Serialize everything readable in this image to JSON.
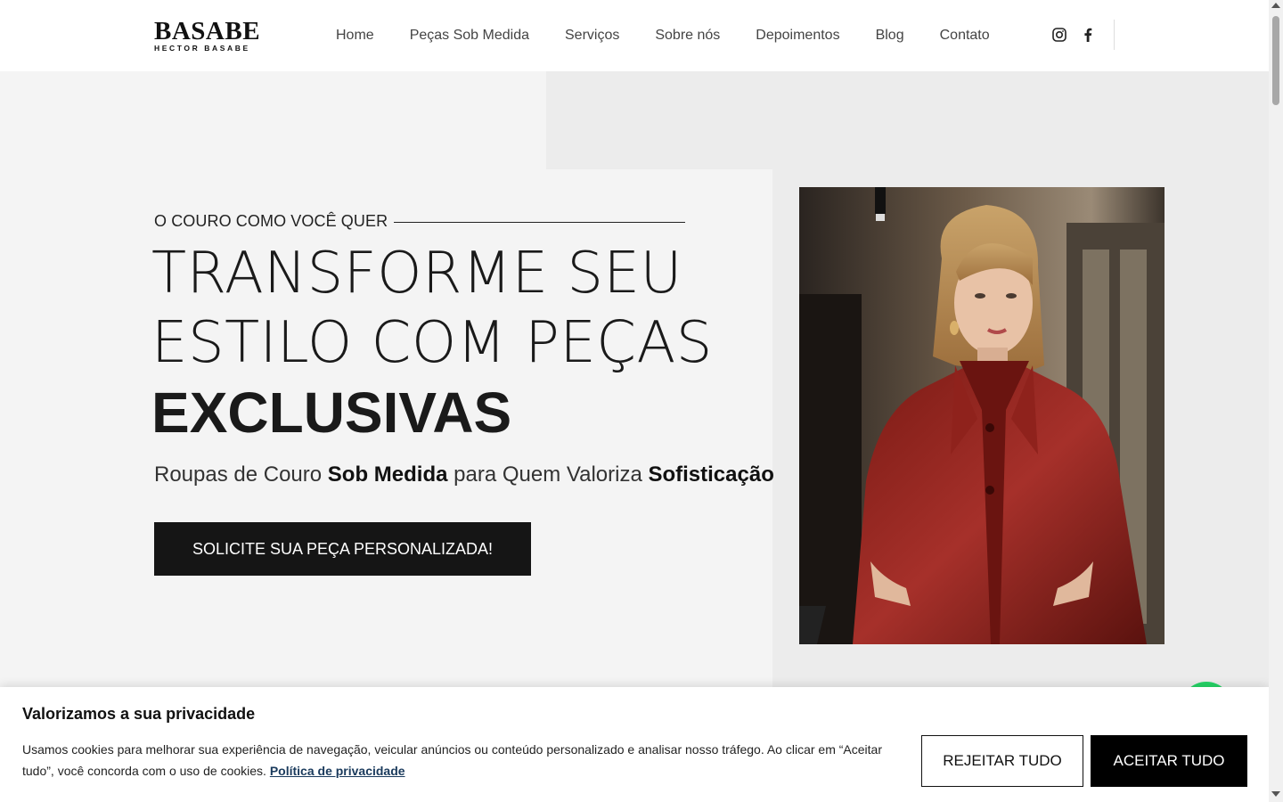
{
  "brand": {
    "name": "BASABE",
    "subname": "HECTOR BASABE"
  },
  "nav": {
    "items": [
      {
        "label": "Home"
      },
      {
        "label": "Peças Sob Medida"
      },
      {
        "label": "Serviços"
      },
      {
        "label": "Sobre nós"
      },
      {
        "label": "Depoimentos"
      },
      {
        "label": "Blog"
      },
      {
        "label": "Contato"
      }
    ]
  },
  "social": {
    "icons": [
      "instagram-icon",
      "facebook-icon"
    ]
  },
  "hero": {
    "eyebrow": "O COURO COMO VOCÊ QUER",
    "headline_line1": "TRANSFORME SEU",
    "headline_line2": "ESTILO COM PEÇAS",
    "headline_bold": "EXCLUSIVAS",
    "sub_part1": "Roupas de Couro ",
    "sub_bold1": "Sob Medida",
    "sub_part2": " para Quem Valoriza ",
    "sub_bold2": "Sofisticação",
    "cta_label": "SOLICITE SUA PEÇA PERSONALIZADA!"
  },
  "cookie": {
    "title": "Valorizamos a sua privacidade",
    "text": "Usamos cookies para melhorar sua experiência de navegação, veicular anúncios ou conteúdo personalizado e analisar nosso tráfego. Ao clicar em “Aceitar tudo”, você concorda com o uso de cookies. ",
    "link_label": "Política de privacidade",
    "reject_label": "REJEITAR TUDO",
    "accept_label": "ACEITAR TUDO"
  },
  "colors": {
    "hero_bg": "#f4f4f4",
    "hero_bg_alt": "#ececec",
    "cta_bg": "#151515",
    "whatsapp": "#25d366",
    "link": "#1a3a5c"
  }
}
